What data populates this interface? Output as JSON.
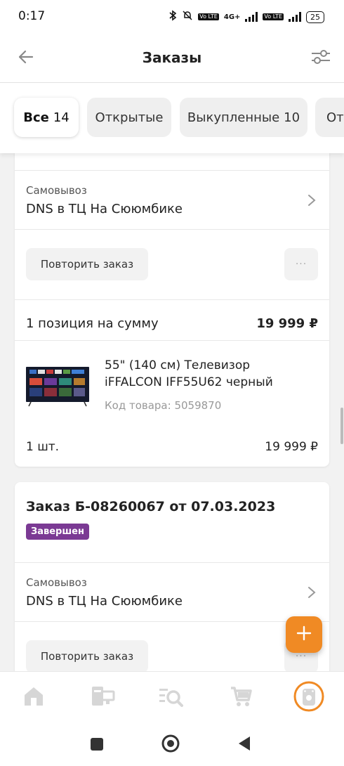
{
  "status_bar": {
    "time": "0:17",
    "network": "4G+",
    "volte": "Vo LTE",
    "battery": "25"
  },
  "header": {
    "title": "Заказы",
    "back_icon": "arrow-left-icon",
    "filter_icon": "sliders-icon"
  },
  "tabs": [
    {
      "label": "Все",
      "count": "14",
      "active": true
    },
    {
      "label": "Открытые",
      "count": "",
      "active": false
    },
    {
      "label": "Выкупленные",
      "count": "10",
      "active": false
    },
    {
      "label": "Отм",
      "count": "",
      "active": false
    }
  ],
  "order1": {
    "delivery_type": "Самовывоз",
    "store": "DNS в ТЦ На Сююмбике",
    "repeat_label": "Повторить заказ",
    "more_label": "···",
    "summary_label": "1 позиция на сумму",
    "summary_total": "19 999 ₽",
    "item": {
      "name_line1": "55\" (140 см) Телевизор",
      "name_line2": "iFFALCON IFF55U62 черный",
      "code": "Код товара: 5059870",
      "qty": "1 шт.",
      "price": "19 999 ₽"
    }
  },
  "order2": {
    "title": "Заказ Б-08260067 от 07.03.2023",
    "status": "Завершен",
    "status_color": "#7b3a94",
    "delivery_type": "Самовывоз",
    "store": "DNS в ТЦ На Сююмбике",
    "repeat_label": "Повторить заказ",
    "more_label": "···"
  },
  "fab": {
    "icon": "plus-icon",
    "color": "#f08a24"
  },
  "bottom_nav": [
    {
      "icon": "home-icon"
    },
    {
      "icon": "catalog-icon"
    },
    {
      "icon": "search-list-icon"
    },
    {
      "icon": "cart-icon"
    },
    {
      "icon": "profile-icon",
      "active": true
    }
  ],
  "accent_color": "#f08a24"
}
